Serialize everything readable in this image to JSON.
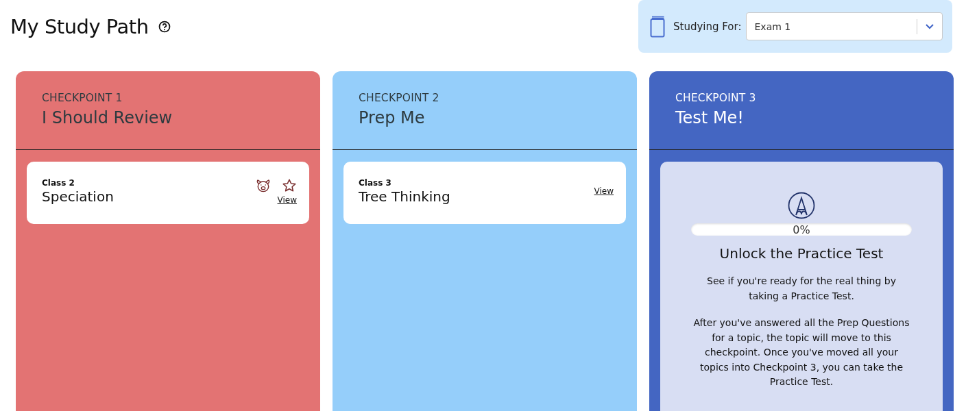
{
  "page": {
    "title": "My Study Path"
  },
  "studying_for": {
    "label": "Studying For:",
    "value": "Exam 1"
  },
  "checkpoints": [
    {
      "kind": "topics",
      "color": "#e37373",
      "dark": false,
      "eyebrow": "CHECKPOINT 1",
      "title": "I Should Review",
      "topics": [
        {
          "class": "Class 2",
          "name": "Speciation",
          "saved": true,
          "starred": false,
          "link": "View"
        }
      ]
    },
    {
      "kind": "topics",
      "color": "#95cefa",
      "dark": false,
      "eyebrow": "CHECKPOINT 2",
      "title": "Prep Me",
      "topics": [
        {
          "class": "Class 3",
          "name": "Tree Thinking",
          "saved": false,
          "starred": false,
          "link": "View"
        }
      ]
    },
    {
      "kind": "unlock",
      "color": "#4466c2",
      "dark": true,
      "eyebrow": "CHECKPOINT 3",
      "title": "Test Me!",
      "progress": {
        "level": 0,
        "reading": "0%"
      },
      "heading": "Unlock the Practice Test",
      "paragraphs": [
        "See if you're ready for the real thing by taking a Practice Test.",
        "After you've answered all the Prep Questions for a topic, the topic will move to this checkpoint. Once you've moved all your topics into Checkpoint 3, you can take the Practice Test."
      ]
    }
  ]
}
